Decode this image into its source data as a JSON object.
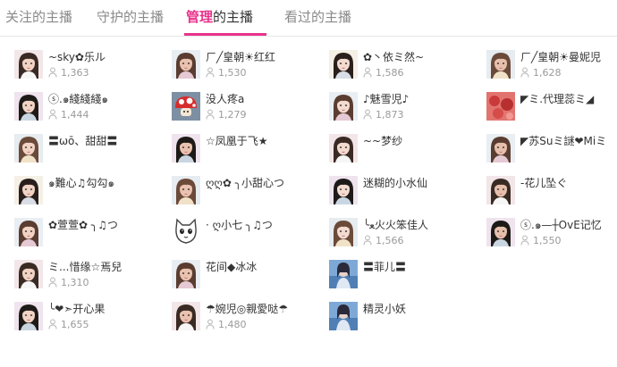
{
  "tabs": {
    "followed": "关注的主播",
    "guarded": "守护的主播",
    "managed_hl": "管理",
    "managed_rest": "的主播",
    "watched": "看过的主播"
  },
  "colors": {
    "accent": "#e8338b",
    "text": "#333333",
    "muted": "#9a9a9a"
  },
  "hosts": [
    {
      "name": "~sky✿乐ル",
      "fans": "1,363",
      "avatar": "portrait"
    },
    {
      "name": "ㄏ╱皇朝☀红红",
      "fans": "1,530",
      "avatar": "portrait"
    },
    {
      "name": "✿丶依ミ然~",
      "fans": "1,586",
      "avatar": "portrait"
    },
    {
      "name": "ㄏ╱皇朝☀曼妮児",
      "fans": "1,628",
      "avatar": "portrait"
    },
    {
      "name": "ⓢ.๑綫綫綫๑",
      "fans": "1,444",
      "avatar": "portrait"
    },
    {
      "name": "没人疼a",
      "fans": "1,279",
      "avatar": "mushroom"
    },
    {
      "name": "♪魅雪児♪",
      "fans": "1,873",
      "avatar": "portrait"
    },
    {
      "name": "◤ミ.代理蕊ミ◢",
      "fans": "",
      "avatar": "red"
    },
    {
      "name": "〓ωō、甜甜〓",
      "fans": "",
      "avatar": "portrait"
    },
    {
      "name": "☆凤凰于飞★",
      "fans": "",
      "avatar": "portrait"
    },
    {
      "name": "~~梦纱",
      "fans": "",
      "avatar": "portrait"
    },
    {
      "name": "◤苏Suミ謎❤Miミ",
      "fans": "",
      "avatar": "portrait"
    },
    {
      "name": "๑難心♫勾勾๑",
      "fans": "",
      "avatar": "portrait"
    },
    {
      "name": "ღღ✿ ╮小甜心つ",
      "fans": "",
      "avatar": "portrait"
    },
    {
      "name": "迷糊的小水仙",
      "fans": "",
      "avatar": "portrait"
    },
    {
      "name": "-花儿坠ぐ",
      "fans": "",
      "avatar": "portrait"
    },
    {
      "name": "✿萱萱✿ ╮♫つ",
      "fans": "",
      "avatar": "portrait"
    },
    {
      "name": "· ღ小七 ╮♫つ",
      "fans": "",
      "avatar": "cat"
    },
    {
      "name": "╰ﻌ火火笨佳人",
      "fans": "1,566",
      "avatar": "portrait"
    },
    {
      "name": "ⓢ.๑—┼OvE记忆",
      "fans": "1,550",
      "avatar": "portrait"
    },
    {
      "name": "ミ...惜缘☆焉兒",
      "fans": "1,310",
      "avatar": "portrait"
    },
    {
      "name": "花间◆冰冰",
      "fans": "",
      "avatar": "portrait"
    },
    {
      "name": "〓菲儿〓",
      "fans": "",
      "avatar": "blue"
    },
    {
      "name": "",
      "fans": "",
      "avatar": "none"
    },
    {
      "name": "╰❤➣开心果",
      "fans": "1,655",
      "avatar": "portrait"
    },
    {
      "name": "☂婉児◎親愛哒☂",
      "fans": "1,480",
      "avatar": "portrait"
    },
    {
      "name": "精灵小妖",
      "fans": "",
      "avatar": "blue"
    },
    {
      "name": "",
      "fans": "",
      "avatar": "none"
    }
  ]
}
